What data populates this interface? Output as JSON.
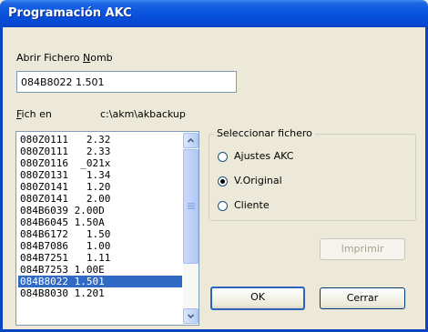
{
  "window": {
    "title": "Programación AKC"
  },
  "file_name": {
    "label_pre": "Abrir Fichero ",
    "label_ul": "N",
    "label_post": "omb",
    "value": "084B8022 1.501"
  },
  "path": {
    "label_ul": "F",
    "label_post": "ich en",
    "value": "c:\\akm\\akbackup"
  },
  "file_list": {
    "items": [
      "080Z0111   2.32",
      "080Z0111   2.33",
      "080Z0116  _021x",
      "080Z0131   1.34",
      "080Z0141   1.20",
      "080Z0141   2.00",
      "084B6039 2.00D",
      "084B6045 1.50A",
      "084B6172   1.50",
      "084B7086   1.00",
      "084B7251   1.11",
      "084B7253 1.00E",
      "084B8022 1.501",
      "084B8030 1.201"
    ],
    "selected_index": 12
  },
  "select_group": {
    "legend": "Seleccionar fichero",
    "options": [
      "Ajustes AKC",
      "V.Original",
      "Cliente"
    ],
    "selected": "V.Original"
  },
  "buttons": {
    "print": "Imprimir",
    "ok": "OK",
    "close": "Cerrar"
  }
}
